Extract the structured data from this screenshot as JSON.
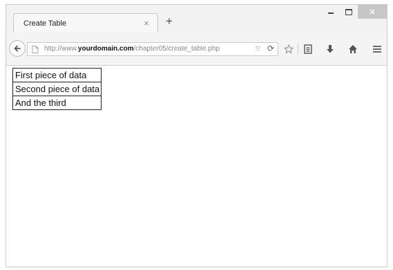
{
  "browser": {
    "tab_title": "Create Table",
    "tab_close": "×",
    "new_tab": "+",
    "url_prefix": "http://www.",
    "url_domain": "yourdomain.com",
    "url_path": "/chapter05/create_table.php",
    "icons": [
      "back-arrow-icon",
      "page-identity-icon",
      "dropdown-arrow-icon",
      "reload-icon",
      "bookmark-star-icon",
      "bookmarks-list-icon",
      "download-icon",
      "home-icon",
      "menu-icon",
      "minimize-icon",
      "maximize-icon",
      "close-icon"
    ]
  },
  "page": {
    "table": {
      "rows": [
        {
          "cell": "First piece of data"
        },
        {
          "cell": "Second piece of data"
        },
        {
          "cell": "And the third"
        }
      ]
    }
  },
  "colors": {
    "chrome_background": "#f2f2f2",
    "close_button": "#c7c7c7",
    "table_border": "#222222"
  }
}
